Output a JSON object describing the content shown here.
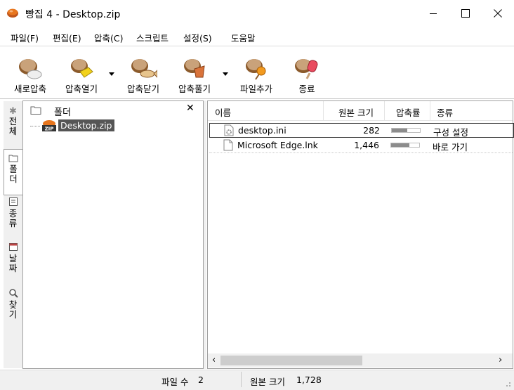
{
  "window": {
    "title": "빵집 4 - Desktop.zip"
  },
  "menu": [
    {
      "label": "파일(F)"
    },
    {
      "label": "편집(E)"
    },
    {
      "label": "압축(C)"
    },
    {
      "label": "스크립트"
    },
    {
      "label": "설정(S)"
    },
    {
      "label": "도움말"
    }
  ],
  "toolbar": {
    "new": "새로압축",
    "open": "압축열기",
    "close": "압축닫기",
    "extract": "압축풀기",
    "add": "파일추가",
    "exit": "종료"
  },
  "side_tabs": {
    "all": "전체",
    "folder": "폴더",
    "type": "종류",
    "date": "날짜",
    "find": "찾기"
  },
  "folder_panel": {
    "header": "폴더",
    "close_symbol": "✕",
    "tree_item": "Desktop.zip",
    "zip_badge": "ZIP"
  },
  "file_list": {
    "columns": {
      "name": "이름",
      "size": "원본 크기",
      "ratio": "압축률",
      "type": "종류"
    },
    "rows": [
      {
        "name": "desktop.ini",
        "size": "282",
        "ratio_fraction": 0.55,
        "type": "구성 설정",
        "icon": "settings-file-icon"
      },
      {
        "name": "Microsoft Edge.lnk",
        "size": "1,446",
        "ratio_fraction": 0.65,
        "type": "바로 가기",
        "icon": "blank-file-icon"
      }
    ]
  },
  "status": {
    "file_count_label": "파일 수",
    "file_count": "2",
    "size_label": "원본 크기",
    "size_value": "1,728"
  },
  "colors": {
    "bread": "#c9a27a",
    "bread_dark": "#8b5a2b",
    "selection": "#555555",
    "accent_orange": "#e8761e"
  }
}
